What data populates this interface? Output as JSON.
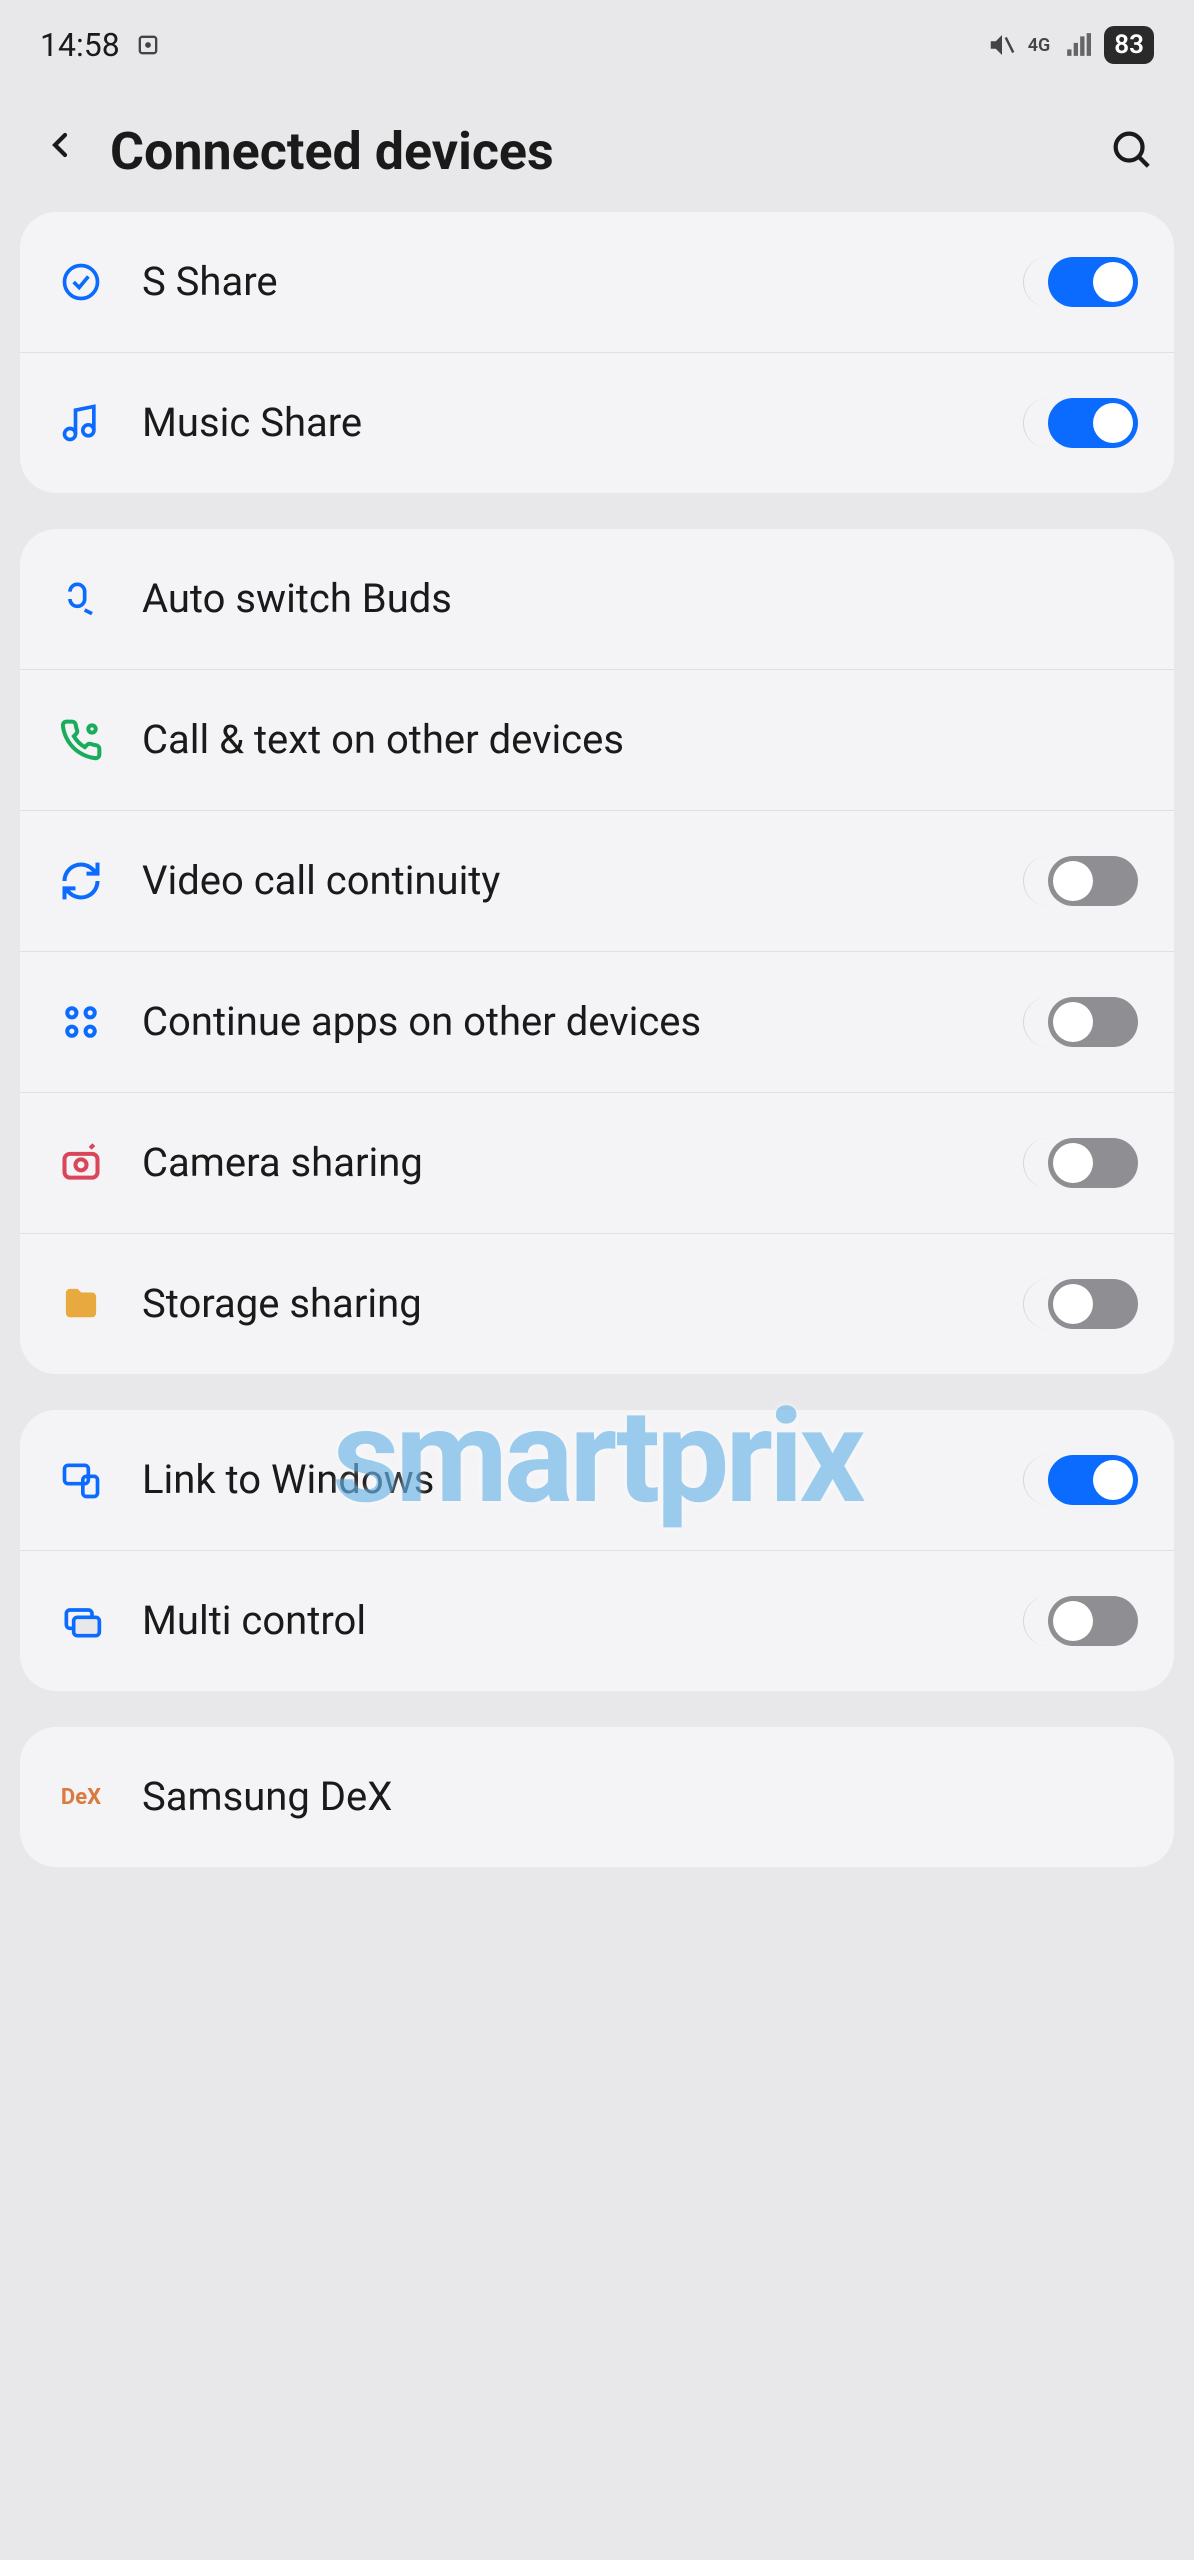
{
  "status": {
    "time": "14:58",
    "battery": "83",
    "network": "4G"
  },
  "header": {
    "title": "Connected devices"
  },
  "sections": [
    {
      "items": [
        {
          "id": "s-share",
          "label": "S Share",
          "icon": "s-share-icon",
          "iconColor": "#0b6bff",
          "toggle": true,
          "on": true
        },
        {
          "id": "music-share",
          "label": "Music Share",
          "icon": "music-icon",
          "iconColor": "#0b6bff",
          "toggle": true,
          "on": true
        }
      ]
    },
    {
      "items": [
        {
          "id": "auto-switch-buds",
          "label": "Auto switch Buds",
          "icon": "buds-icon",
          "iconColor": "#0b6bff",
          "toggle": false
        },
        {
          "id": "call-text",
          "label": "Call & text on other devices",
          "icon": "phone-icon",
          "iconColor": "#1aab5c",
          "toggle": false
        },
        {
          "id": "video-call",
          "label": "Video call continuity",
          "icon": "sync-icon",
          "iconColor": "#0b6bff",
          "toggle": true,
          "on": false
        },
        {
          "id": "continue-apps",
          "label": "Continue apps on other devices",
          "icon": "grid-icon",
          "iconColor": "#0b6bff",
          "toggle": true,
          "on": false
        },
        {
          "id": "camera-sharing",
          "label": "Camera sharing",
          "icon": "camera-icon",
          "iconColor": "#d9465a",
          "toggle": true,
          "on": false
        },
        {
          "id": "storage-sharing",
          "label": "Storage sharing",
          "icon": "folder-icon",
          "iconColor": "#e8a93e",
          "toggle": true,
          "on": false
        }
      ]
    },
    {
      "items": [
        {
          "id": "link-windows",
          "label": "Link to Windows",
          "icon": "link-icon",
          "iconColor": "#0b6bff",
          "toggle": true,
          "on": true
        },
        {
          "id": "multi-control",
          "label": "Multi control",
          "icon": "multi-icon",
          "iconColor": "#0b6bff",
          "toggle": true,
          "on": false
        }
      ]
    },
    {
      "items": [
        {
          "id": "samsung-dex",
          "label": "Samsung DeX",
          "icon": "dex-icon",
          "iconColor": "#d97a3e",
          "toggle": false
        }
      ]
    }
  ],
  "watermark": "smartprix"
}
